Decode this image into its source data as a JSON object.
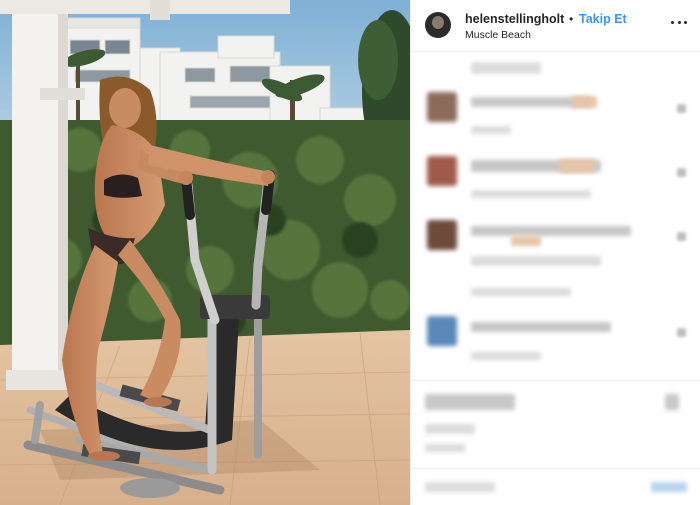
{
  "post": {
    "username": "helenstellingholt",
    "separator": "•",
    "follow_label": "Takip Et",
    "location": "Muscle Beach",
    "more_icon": "more-options-icon"
  },
  "photo": {
    "subject": "woman-on-elliptical-trainer",
    "sky_color": "#8fb8d6",
    "accent": "#3897f0"
  },
  "comments": {
    "blurred": true,
    "count": 4
  }
}
